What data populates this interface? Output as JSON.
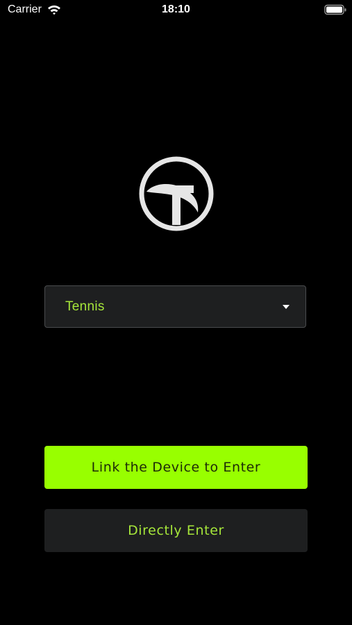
{
  "status_bar": {
    "carrier": "Carrier",
    "time": "18:10",
    "icons": [
      "wifi-icon",
      "battery-icon"
    ]
  },
  "logo": {
    "icon": "tennis-logo-icon",
    "letter": "T"
  },
  "sport_select": {
    "selected_value": "Tennis",
    "icon": "dropdown-caret-icon"
  },
  "actions": {
    "link_device_label": "Link the Device to Enter",
    "direct_enter_label": "Directly Enter"
  },
  "colors": {
    "background": "#000000",
    "accent_green": "#98ff00",
    "text_green": "#a6e63a",
    "surface": "#1e1f20",
    "logo": "#e6e6e6"
  }
}
